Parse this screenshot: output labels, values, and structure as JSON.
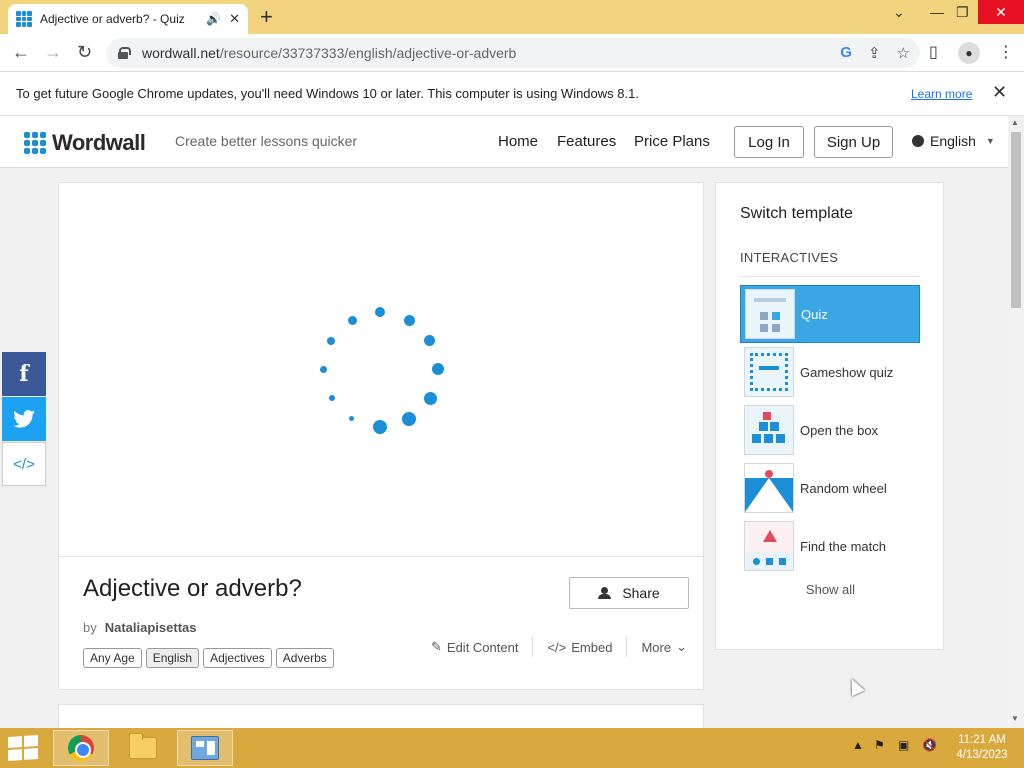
{
  "browser": {
    "tab_title": "Adjective or adverb? - Quiz",
    "url_host": "wordwall.net",
    "url_path": "/resource/33737333/english/adjective-or-adverb",
    "infobar_text": "To get future Google Chrome updates, you'll need Windows 10 or later. This computer is using Windows 8.1.",
    "infobar_link": "Learn more"
  },
  "site": {
    "logo_text": "Wordwall",
    "tagline": "Create better lessons quicker",
    "nav": [
      "Home",
      "Features",
      "Price Plans"
    ],
    "login": "Log In",
    "signup": "Sign Up",
    "language": "English"
  },
  "activity": {
    "title": "Adjective or adverb?",
    "by_label": "by",
    "author": "Nataliapisettas",
    "share": "Share",
    "tags": [
      "Any Age",
      "English",
      "Adjectives",
      "Adverbs"
    ],
    "edit": "Edit Content",
    "embed": "Embed",
    "more": "More"
  },
  "sidebar": {
    "title": "Switch template",
    "section": "INTERACTIVES",
    "templates": [
      "Quiz",
      "Gameshow quiz",
      "Open the box",
      "Random wheel",
      "Find the match"
    ],
    "selected": "Quiz",
    "show_all": "Show all"
  },
  "taskbar": {
    "time": "11:21 AM",
    "date": "4/13/2023"
  },
  "colors": {
    "accent": "#1a8fd8",
    "selected_template": "#3aa6e6",
    "tab_strip": "#f2d37e",
    "taskbar": "#d9a93e",
    "facebook": "#3b5998",
    "twitter": "#1da1f2"
  }
}
